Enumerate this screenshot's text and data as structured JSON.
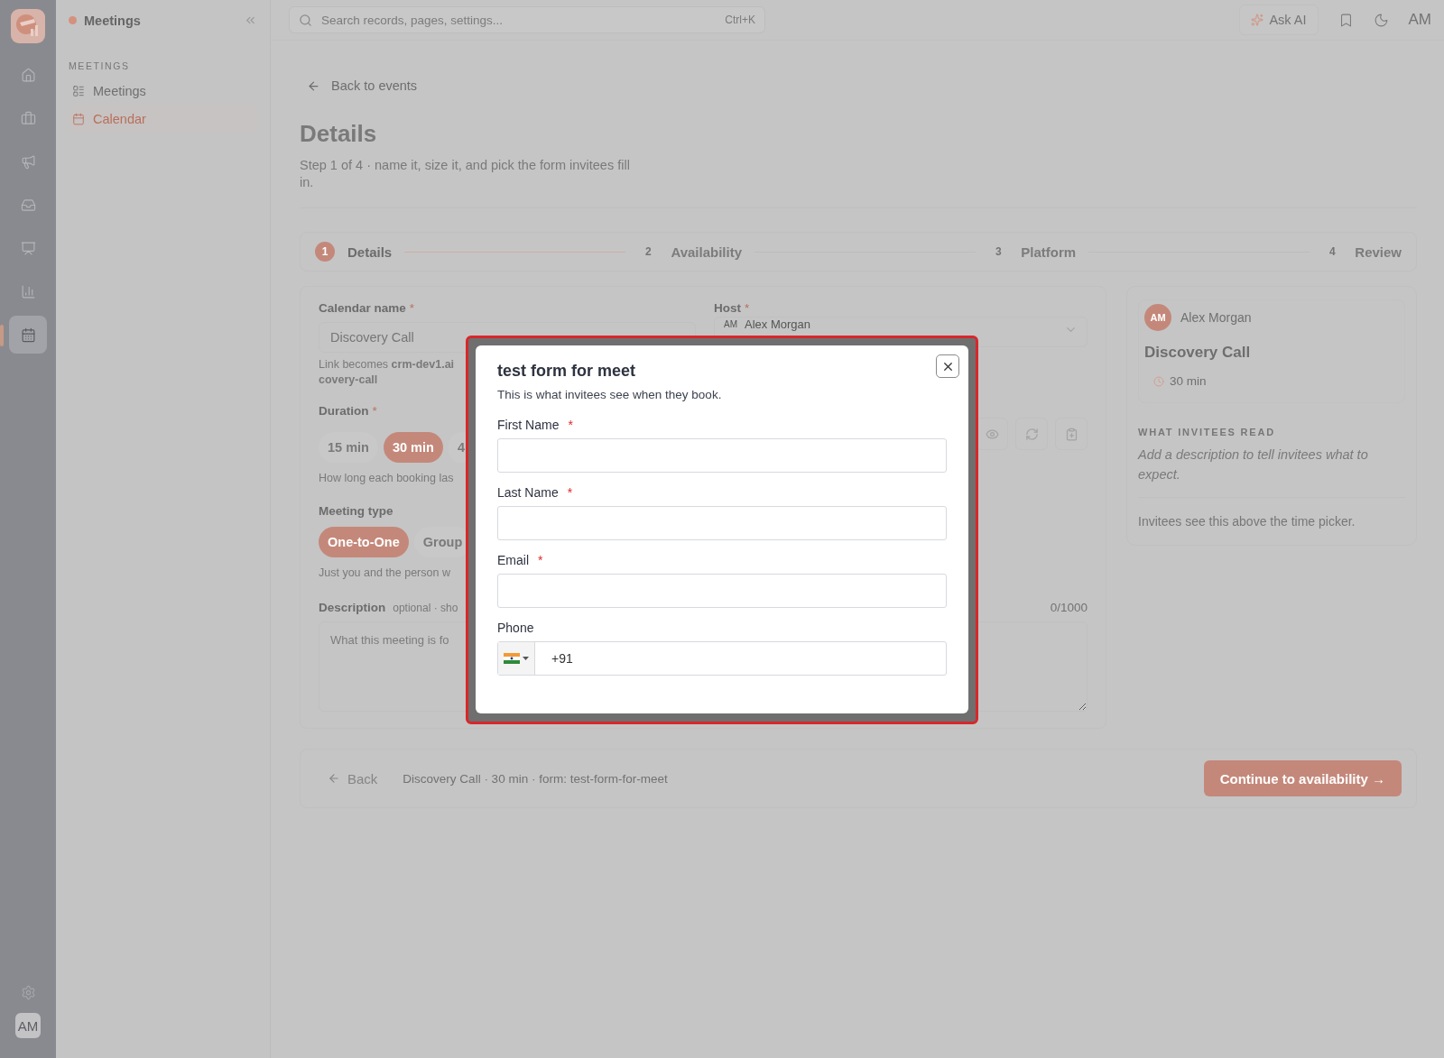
{
  "rail": {
    "items": [
      {
        "kind": "home",
        "selected": false
      },
      {
        "kind": "briefcase",
        "selected": false
      },
      {
        "kind": "megaphone",
        "selected": false
      },
      {
        "kind": "inbox",
        "selected": false
      },
      {
        "kind": "presentation",
        "selected": false
      },
      {
        "kind": "chart",
        "selected": false
      },
      {
        "kind": "calendar",
        "selected": true
      }
    ],
    "avatar": "AM"
  },
  "sidebar": {
    "title": "Meetings",
    "section": "MEETINGS",
    "items": [
      {
        "label": "Meetings",
        "kind": "list",
        "selected": false
      },
      {
        "label": "Calendar",
        "kind": "calendar",
        "selected": true
      }
    ]
  },
  "topbar": {
    "search_placeholder": "Search records, pages, settings...",
    "shortcut": "Ctrl+K",
    "ask_ai": "Ask AI",
    "user": "AM"
  },
  "page": {
    "back": "Back to events",
    "title": "Details",
    "subtitle": "Step 1 of 4 · name it, size it, and pick the form invitees fill in."
  },
  "steps": [
    {
      "number": "1",
      "label": "Details",
      "selected": true
    },
    {
      "number": "2",
      "label": "Availability",
      "selected": false
    },
    {
      "number": "3",
      "label": "Platform",
      "selected": false
    },
    {
      "number": "4",
      "label": "Review",
      "selected": false
    }
  ],
  "form": {
    "name_label": "Calendar name",
    "name_mark": "*",
    "name_value": "Discovery Call",
    "link_lines": [
      "Link becomes **crm-dev1.ai**",
      "**covery-call**"
    ],
    "duration_label": "Duration",
    "duration_mark": "*",
    "durations": [
      {
        "label": "15 min",
        "selected": false
      },
      {
        "label": "30 min",
        "selected": true
      },
      {
        "label": "4",
        "selected": false
      }
    ],
    "duration_help": "How long each booking las",
    "type_label": "Meeting type",
    "types": [
      {
        "label": "One-to-One",
        "selected": true
      },
      {
        "label": "Group",
        "selected": false
      }
    ],
    "type_help": "Just you and the person w",
    "description_label": "Description",
    "description_hint": "optional · sho",
    "description_placeholder": "What this meeting is fo",
    "counter": "0/1000",
    "host_label": "Host",
    "host_mark": "*",
    "host_initials": "AM",
    "host_name": "Alex Morgan"
  },
  "preview": {
    "initials": "AM",
    "name": "Alex Morgan",
    "title": "Discovery Call",
    "duration": "30 min",
    "section": "WHAT INVITEES READ",
    "description": "Add a description to tell invitees what to expect.",
    "note": "Invitees see this above the time picker."
  },
  "footer": {
    "back": "Back",
    "summary": "Discovery Call · 30 min · form: test-form-for-meet",
    "continue": "Continue to availability →"
  },
  "modal": {
    "title": "test form for meet",
    "subtitle": "This is what invitees see when they book.",
    "fields": [
      {
        "label": "First Name",
        "mark": "*",
        "kind": "text"
      },
      {
        "label": "Last Name",
        "mark": "*",
        "kind": "text"
      },
      {
        "label": "Email",
        "mark": "*",
        "kind": "text"
      },
      {
        "label": "Phone",
        "kind": "phone",
        "value": "+91"
      }
    ]
  }
}
